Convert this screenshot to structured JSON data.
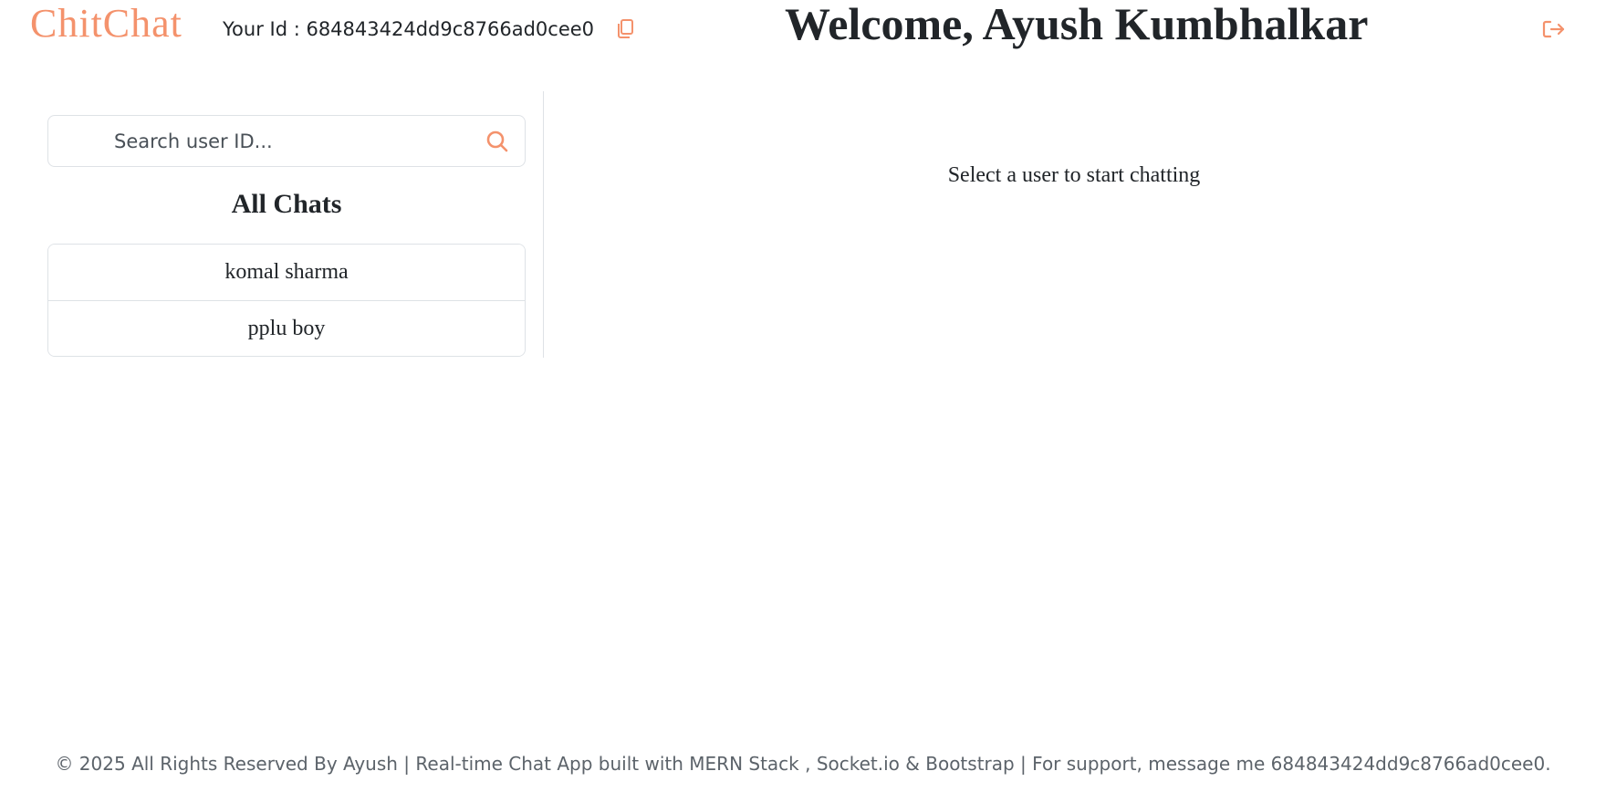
{
  "header": {
    "brand": "ChitChat",
    "user_id_text": "Your Id : 684843424dd9c8766ad0cee0",
    "welcome": "Welcome, Ayush Kumbhalkar",
    "copy_icon": "copy-icon",
    "logout_icon": "logout-icon"
  },
  "sidebar": {
    "search": {
      "placeholder": "Search user ID...",
      "value": "",
      "icon": "search-icon"
    },
    "heading": "All Chats",
    "chats": [
      {
        "name": "komal sharma"
      },
      {
        "name": "pplu boy"
      }
    ]
  },
  "main": {
    "empty_state": "Select a user to start chatting"
  },
  "footer": {
    "text": "© 2025 All Rights Reserved By Ayush | Real-time Chat App built with MERN Stack , Socket.io & Bootstrap | For support, message me 684843424dd9c8766ad0cee0."
  },
  "colors": {
    "accent": "#f4926c",
    "text": "#212529",
    "border": "#dee2e6",
    "muted": "#5c636a"
  }
}
